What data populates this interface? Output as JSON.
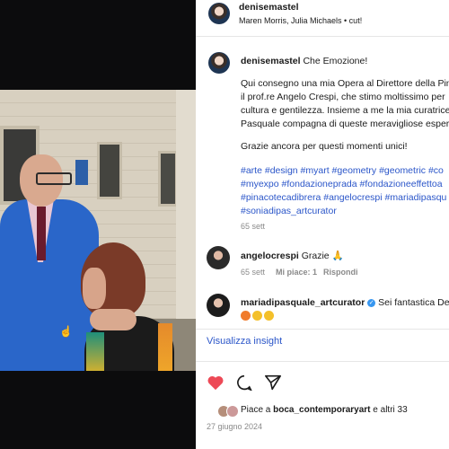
{
  "header": {
    "username": "denisemastel",
    "audio": "Maren Morris, Julia Michaels • cut!"
  },
  "caption": {
    "username": "denisemastel",
    "title": "Che Emozione!",
    "lines": [
      "Qui consegno una mia Opera al Direttore della Pin",
      "il prof.re Angelo Crespi, che stimo moltissimo per",
      "cultura e gentilezza. Insieme a me la mia curatrice",
      "Pasquale compagna di queste meravigliose esperi"
    ],
    "thanks": "Grazie ancora per questi momenti unici!",
    "hashtag_lines": [
      "#arte #design #myart #geometry #geometric #co",
      "#myexpo #fondazioneprada #fondazioneeffettoa",
      "#pinacotecadibrera #angelocrespi #mariadipasqu",
      "#soniadipas_artcurator"
    ],
    "date": "65 sett"
  },
  "comments": [
    {
      "username": "angelocrespi",
      "text": "Grazie 🙏",
      "date": "65 sett",
      "likes": "Mi piace: 1",
      "reply": "Rispondi"
    },
    {
      "username": "mariadipasquale_artcurator",
      "text": "Sei fantastica De",
      "emoji_count": 3
    }
  ],
  "insights_link": "Visualizza insight",
  "likes": {
    "prefix": "Piace a ",
    "user": "boca_contemporaryart",
    "suffix": " e altri 33"
  },
  "post_date": "27 giugno 2024",
  "icons": [
    "heart-icon",
    "comment-icon",
    "send-icon",
    "verified-icon"
  ],
  "colors": {
    "link": "#2b56c9",
    "heart": "#ed4956",
    "verified": "#3897f0"
  }
}
